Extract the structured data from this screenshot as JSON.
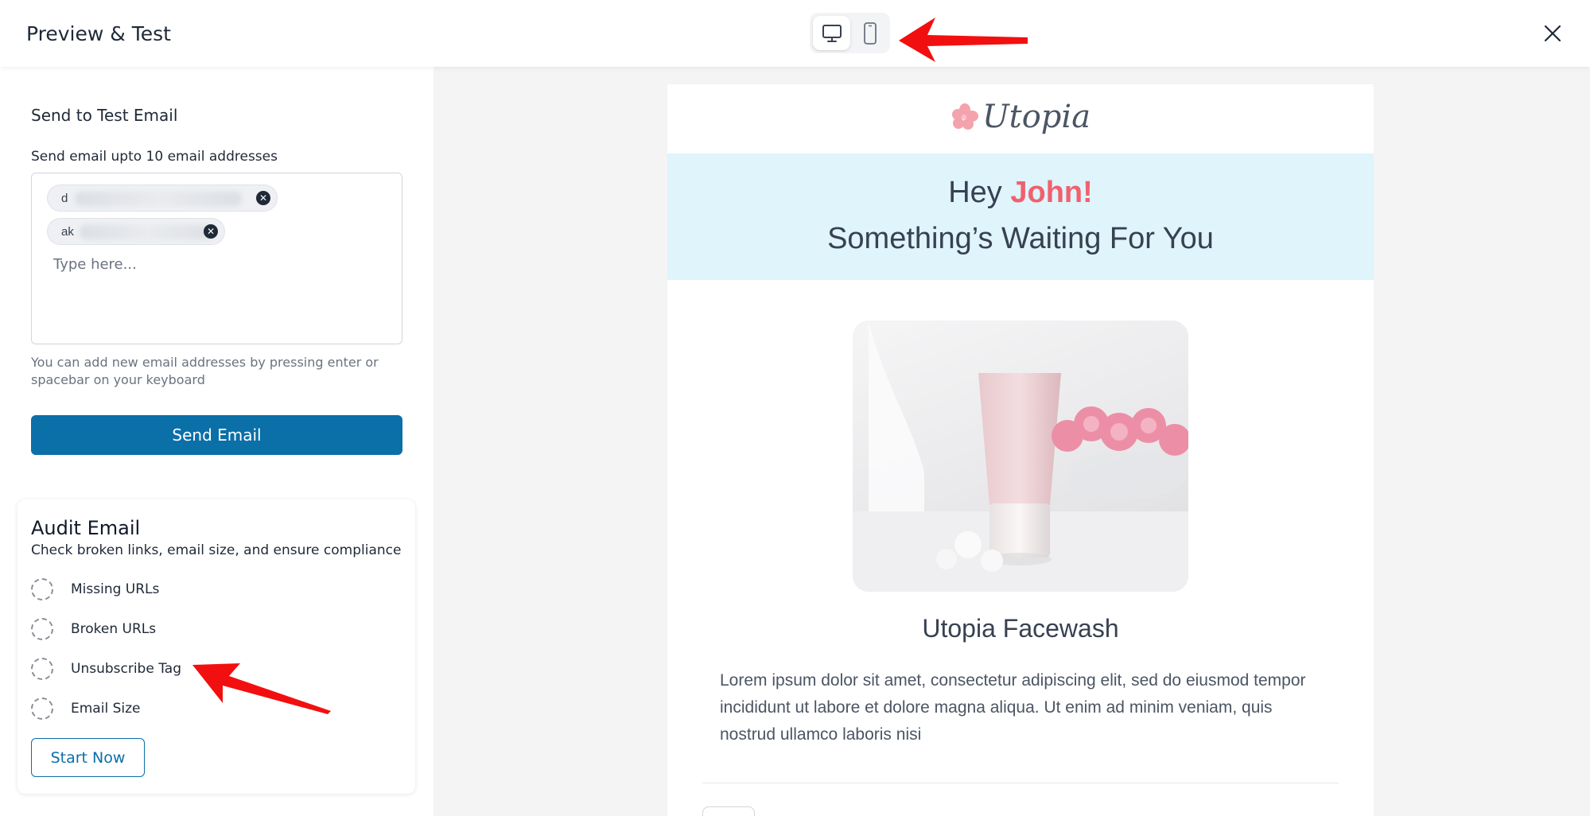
{
  "header": {
    "title": "Preview & Test",
    "device_toggle": {
      "desktop_icon": "desktop-icon",
      "mobile_icon": "mobile-icon",
      "selected": "desktop"
    },
    "close_icon": "close-icon"
  },
  "test_email": {
    "section_title": "Send to Test Email",
    "field_label": "Send email upto 10 email addresses",
    "chips": [
      {
        "visible_text": "d"
      },
      {
        "visible_text": "ak"
      }
    ],
    "input_placeholder": "Type here...",
    "helper_text": "You can add new email addresses by pressing enter or spacebar on your keyboard",
    "send_button": "Send Email"
  },
  "audit": {
    "title": "Audit Email",
    "description": "Check broken links, email size, and ensure compliance",
    "items": [
      {
        "label": "Missing URLs"
      },
      {
        "label": "Broken URLs"
      },
      {
        "label": "Unsubscribe Tag"
      },
      {
        "label": "Email Size"
      }
    ],
    "start_button": "Start Now"
  },
  "email_preview": {
    "logo_text": "Utopia",
    "greeting_prefix": "Hey ",
    "greeting_name": "John!",
    "subheading": "Something’s Waiting For You",
    "product_title": "Utopia Facewash",
    "product_description": "Lorem ipsum dolor sit amet, consectetur adipiscing elit, sed do eiusmod tempor incididunt ut labore et dolore magna aliqua. Ut enim ad minim veniam, quis nostrud ullamco laboris nisi",
    "colors": {
      "hero_bg": "#dff4fb",
      "name_accent": "#f0616d",
      "logo_flower": "#f4a3ad"
    }
  },
  "colors": {
    "primary": "#0b6fa8",
    "annotation_arrow": "#f20f0f"
  }
}
